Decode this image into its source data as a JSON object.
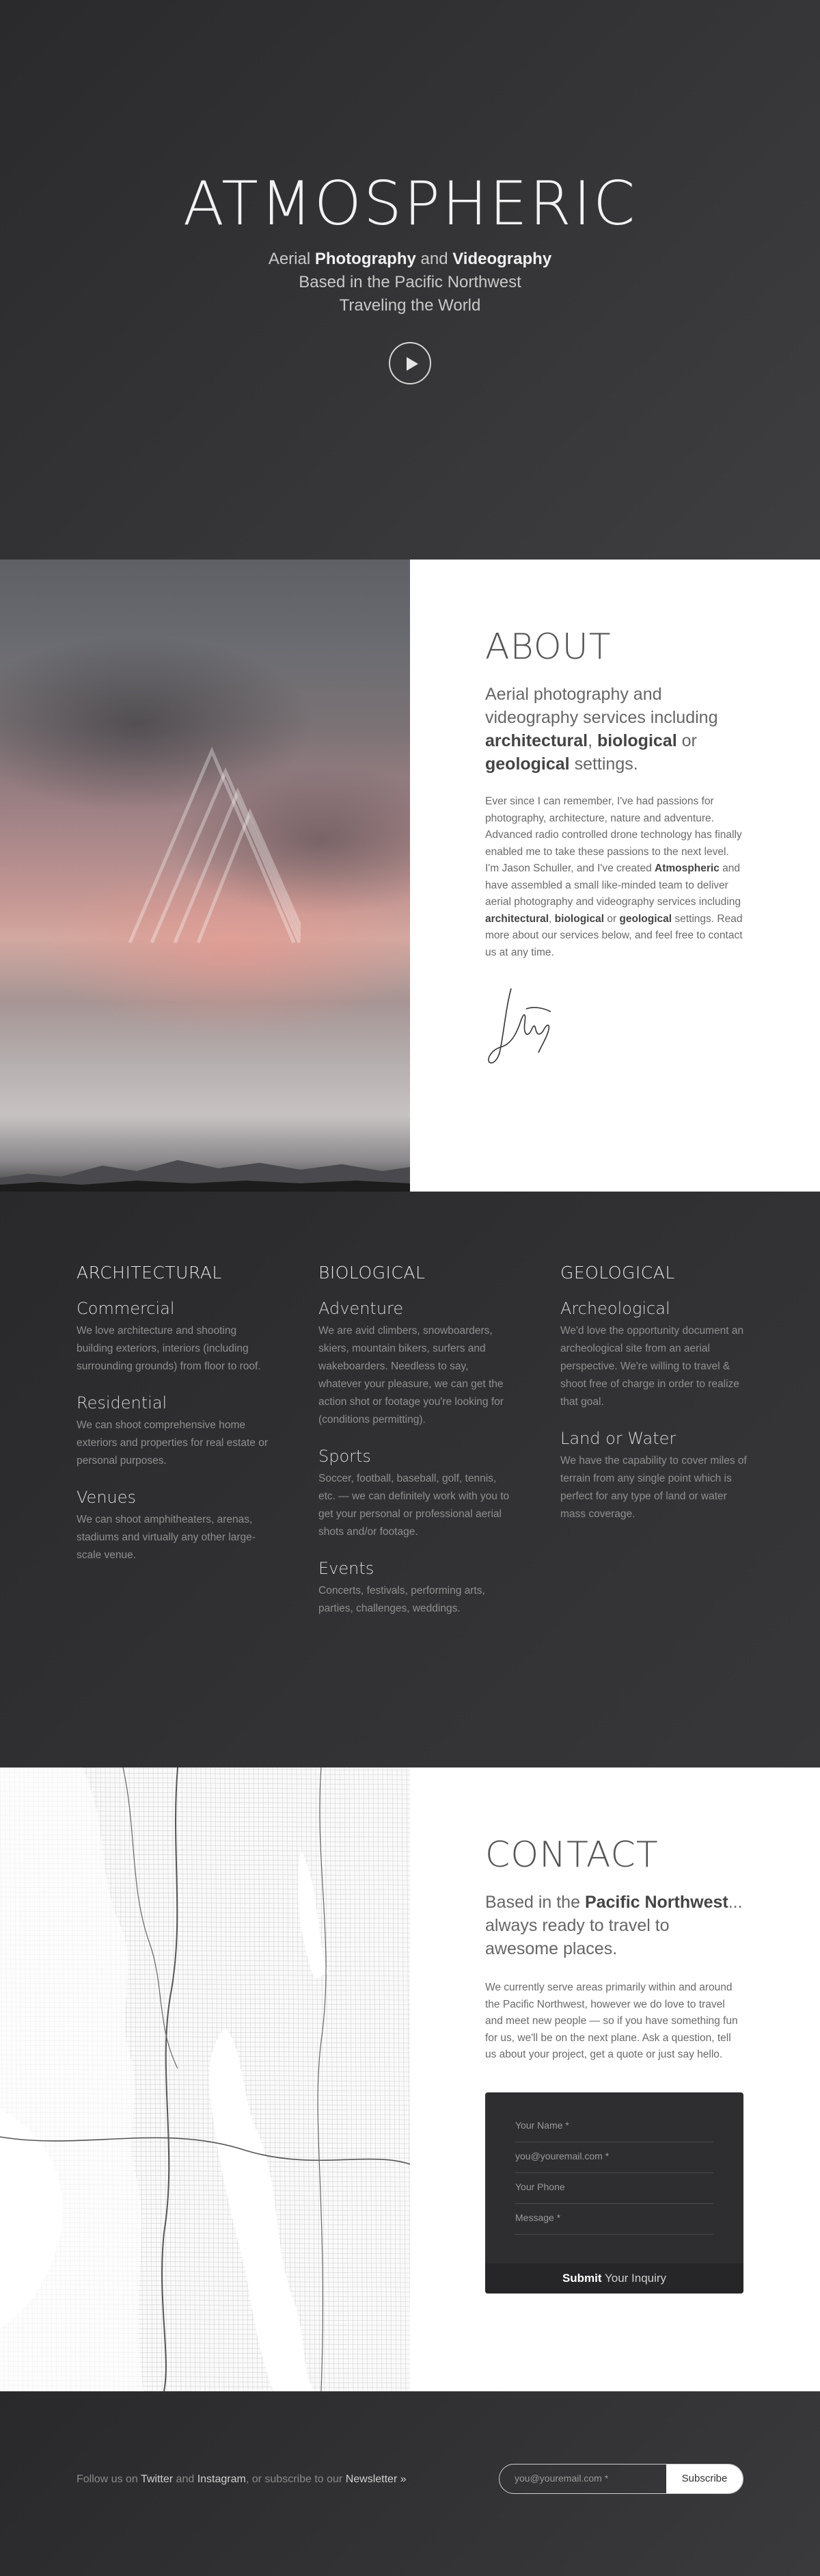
{
  "hero": {
    "title": "ATMOSPHERIC",
    "line1_pre": "Aerial ",
    "line1_b1": "Photography",
    "line1_mid": " and ",
    "line1_b2": "Videography",
    "line2": "Based in the Pacific Northwest",
    "line3": "Traveling the World",
    "play_icon": "play-icon"
  },
  "about": {
    "heading": "ABOUT",
    "lead_pre": "Aerial photography and videography services including ",
    "lead_b1": "architectural",
    "lead_sep": ", ",
    "lead_b2": "biological",
    "lead_or": " or ",
    "lead_b3": "geological",
    "lead_post": " settings.",
    "body_1": "Ever since I can remember, I've had passions for photography, architecture, nature and adventure. Advanced radio controlled drone technology has finally enabled me to take these passions to the next level. I'm Jason Schuller, and I've created ",
    "body_b1": "Atmospheric",
    "body_2": " and have assembled a small like-minded team to deliver aerial photography and videography services including ",
    "body_b2": "architectural",
    "body_3": ", ",
    "body_b3": "biological",
    "body_4": " or ",
    "body_b4": "geological",
    "body_5": " settings. Read more about our services below, and feel free to contact us at any time."
  },
  "services": {
    "columns": [
      {
        "title": "ARCHITECTURAL",
        "items": [
          {
            "name": "Commercial",
            "text": "We love architecture and shooting building exteriors, interiors (including surrounding grounds) from floor to roof."
          },
          {
            "name": "Residential",
            "text": "We can shoot comprehensive home exteriors and properties for real estate or personal purposes."
          },
          {
            "name": "Venues",
            "text": "We can shoot amphitheaters, arenas, stadiums and virtually any other large-scale venue."
          }
        ]
      },
      {
        "title": "BIOLOGICAL",
        "items": [
          {
            "name": "Adventure",
            "text": "We are avid climbers, snowboarders, skiers, mountain bikers, surfers and wakeboarders. Needless to say, whatever your pleasure, we can get the action shot or footage you're looking for (conditions permitting)."
          },
          {
            "name": "Sports",
            "text": "Soccer, football, baseball, golf, tennis, etc. — we can definitely work with you to get your personal or professional aerial shots and/or footage."
          },
          {
            "name": "Events",
            "text": "Concerts, festivals, performing arts, parties, challenges, weddings."
          }
        ]
      },
      {
        "title": "GEOLOGICAL",
        "items": [
          {
            "name": "Archeological",
            "text": "We'd love the opportunity document an archeological site from an aerial perspective. We're willing to travel & shoot free of charge in order to realize that goal."
          },
          {
            "name": "Land or Water",
            "text": "We have the capability to cover miles of terrain from any single point which is perfect for any type of land or water mass coverage."
          }
        ]
      }
    ]
  },
  "contact": {
    "heading": "CONTACT",
    "lead_pre": "Based in the ",
    "lead_b": "Pacific Northwest",
    "lead_post": "... always ready to travel to awesome places.",
    "body": "We currently serve areas primarily within and around the Pacific Northwest, however we do love to travel and meet new people — so if you have something fun for us, we'll be on the next plane. Ask a question, tell us about your project, get a quote or just say hello.",
    "form": {
      "name_placeholder": "Your Name *",
      "email_placeholder": "you@youremail.com *",
      "phone_placeholder": "Your Phone",
      "message_placeholder": "Message *",
      "submit_b": "Submit",
      "submit_rest": " Your Inquiry"
    }
  },
  "footer": {
    "follow_1": "Follow us on ",
    "twitter": "Twitter",
    "and": " and ",
    "instagram": "Instagram",
    "follow_2": ", or subscribe to our ",
    "newsletter": "Newsletter »",
    "email_placeholder": "you@youremail.com *",
    "subscribe": "Subscribe"
  }
}
